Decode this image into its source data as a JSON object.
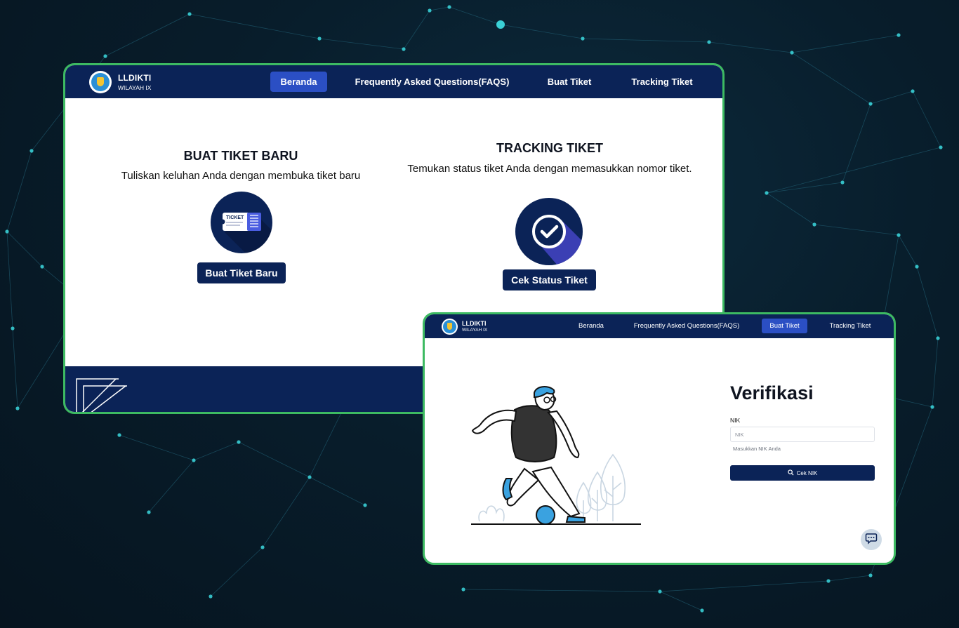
{
  "window1": {
    "brand": {
      "name": "LLDIKTI",
      "subtitle": "WILAYAH IX"
    },
    "nav": {
      "beranda": "Beranda",
      "faqs": "Frequently Asked Questions(FAQS)",
      "buat_tiket": "Buat Tiket",
      "tracking_tiket": "Tracking Tiket",
      "active": "Beranda"
    },
    "left_card": {
      "title": "BUAT TIKET BARU",
      "description": "Tuliskan keluhan Anda dengan membuka tiket baru",
      "icon_text": "TICKET",
      "icon": "ticket-icon",
      "button": "Buat Tiket Baru"
    },
    "right_card": {
      "title": "TRACKING TIKET",
      "description": "Temukan status tiket Anda dengan memasukkan nomor tiket.",
      "icon": "check-circle-icon",
      "button": "Cek Status Tiket"
    }
  },
  "window2": {
    "brand": {
      "name": "LLDIKTI",
      "subtitle": "WILAYAH IX"
    },
    "nav": {
      "beranda": "Beranda",
      "faqs": "Frequently Asked Questions(FAQS)",
      "buat_tiket": "Buat Tiket",
      "tracking_tiket": "Tracking Tiket",
      "active": "Buat Tiket"
    },
    "form": {
      "title": "Verifikasi",
      "nik_label": "NIK",
      "nik_placeholder": "NIK",
      "nik_value": "",
      "nik_hint": "Masukkan NIK Anda",
      "submit": "Cek NIK",
      "submit_icon": "search-icon"
    },
    "chat_icon": "chat-icon"
  },
  "colors": {
    "navy": "#0b2357",
    "active_nav": "#2b4fc4",
    "frame_border": "#3dba62",
    "illustration_accent": "#3aa2e0",
    "background": "#081d2b"
  }
}
